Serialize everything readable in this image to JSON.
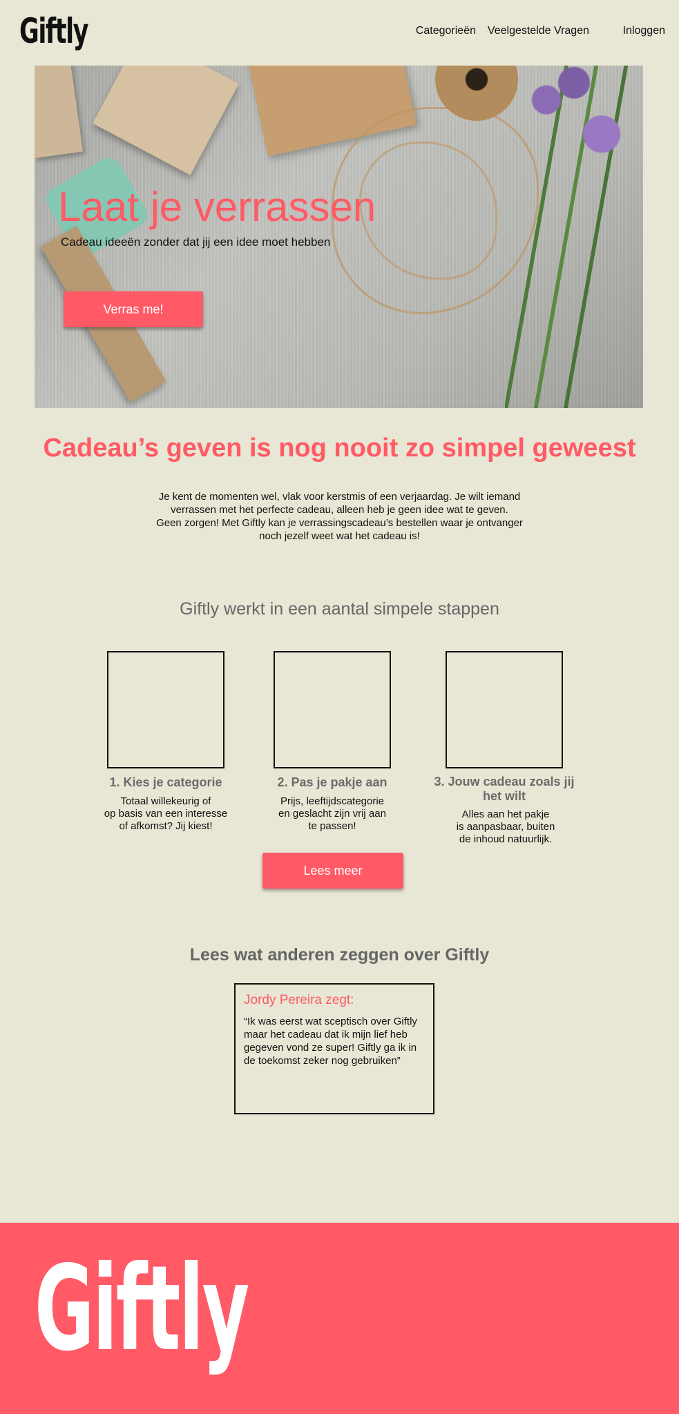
{
  "header": {
    "logo": "Giftly",
    "nav": [
      "Categorieën",
      "Veelgestelde Vragen",
      "Inloggen"
    ]
  },
  "hero": {
    "title": "Laat je verrassen",
    "subtitle": "Cadeau ideeën zonder dat jij een idee moet hebben",
    "button": "Verras me!"
  },
  "intro": {
    "title": "Cadeau’s geven is nog nooit zo simpel geweest",
    "lines": [
      "Je kent de momenten wel, vlak voor kerstmis of een verjaardag. Je wilt iemand",
      "verrassen met het perfecte cadeau, alleen heb je geen idee wat te geven.",
      "Geen zorgen! Met Giftly kan je verrassingscadeau’s bestellen waar je ontvanger",
      "noch jezelf weet wat het cadeau is!"
    ]
  },
  "steps": {
    "title": "Giftly werkt in een aantal simpele stappen",
    "items": [
      {
        "head": "1. Kies je categorie",
        "text": [
          "Totaal willekeurig of",
          "op basis van een interesse",
          "of afkomst? Jij kiest!"
        ]
      },
      {
        "head": "2. Pas je pakje aan",
        "text": [
          "Prijs, leeftijdscategorie",
          "en geslacht zijn vrij aan",
          "te passen!"
        ]
      },
      {
        "head": [
          "3. Jouw cadeau zoals jij",
          "het wilt"
        ],
        "text": [
          "Alles aan het pakje",
          "is aanpasbaar, buiten",
          "de inhoud natuurlijk."
        ]
      }
    ],
    "button": "Lees meer"
  },
  "testimonials": {
    "title": "Lees wat anderen zeggen over Giftly",
    "name": "Jordy Pereira zegt:",
    "quote": [
      "“Ik was eerst wat sceptisch over Giftly",
      "maar het cadeau dat ik mijn lief heb",
      "gegeven vond ze super! Giftly ga ik in",
      "de toekomst zeker nog gebruiken”"
    ]
  },
  "footer": {
    "logo": "Giftly"
  },
  "colors": {
    "background": "#e8e6d4",
    "accent": "#ff5a65"
  }
}
